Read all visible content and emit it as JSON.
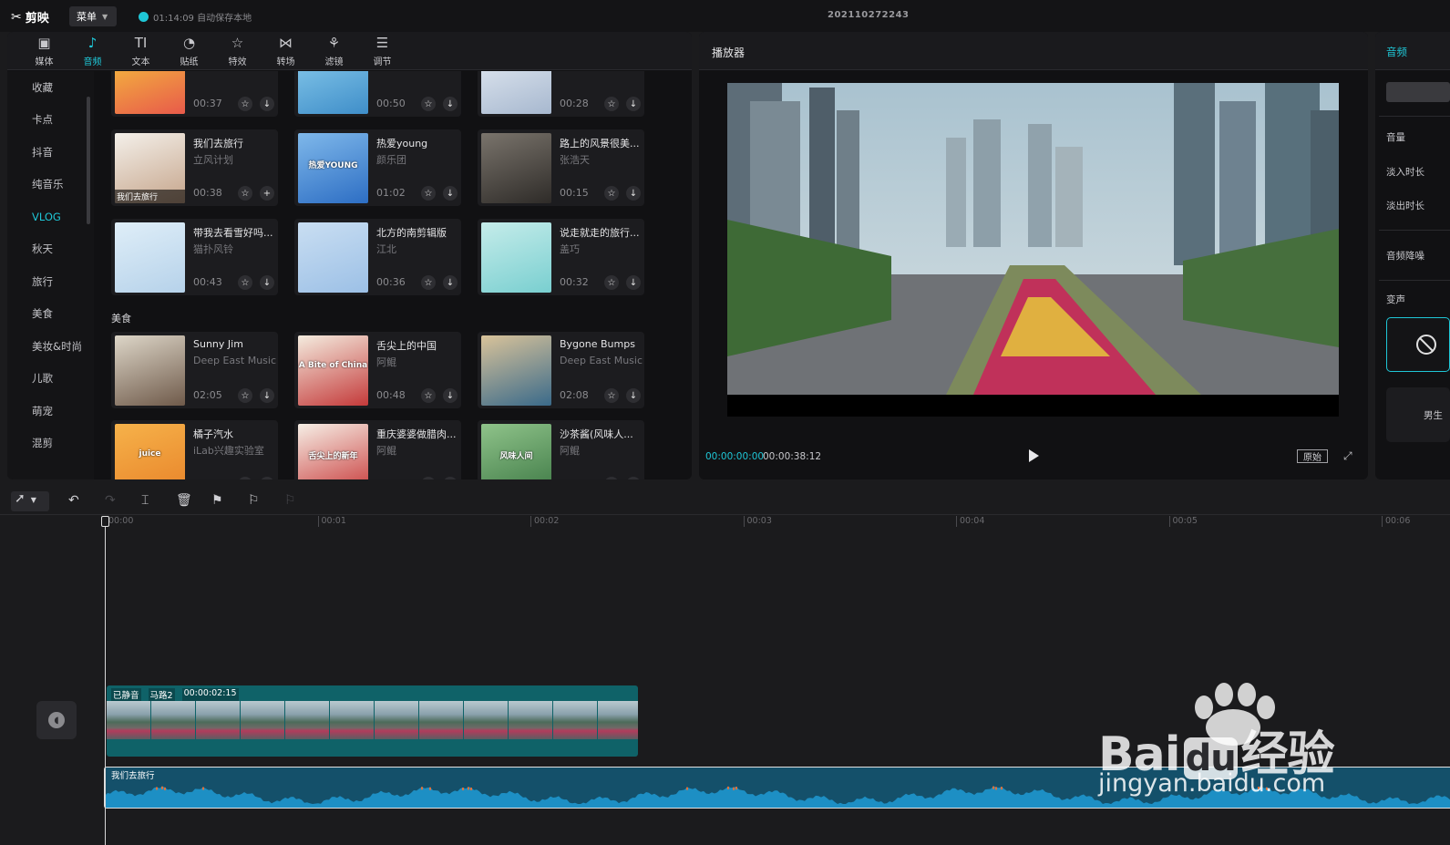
{
  "app": {
    "logo_text": "剪映",
    "menu_label": "菜单",
    "save_status": "01:14:09 自动保存本地",
    "project_title": "202110272243"
  },
  "tabs": [
    {
      "label": "媒体",
      "icon": "media-icon",
      "glyph": "▣"
    },
    {
      "label": "音频",
      "icon": "music-note-icon",
      "glyph": "♪"
    },
    {
      "label": "文本",
      "icon": "text-icon",
      "glyph": "TI"
    },
    {
      "label": "贴纸",
      "icon": "sticker-icon",
      "glyph": "◔"
    },
    {
      "label": "特效",
      "icon": "effects-star-icon",
      "glyph": "☆"
    },
    {
      "label": "转场",
      "icon": "transition-icon",
      "glyph": "⋈"
    },
    {
      "label": "滤镜",
      "icon": "filter-icon",
      "glyph": "⚘"
    },
    {
      "label": "调节",
      "icon": "adjust-sliders-icon",
      "glyph": "☰"
    }
  ],
  "categories": [
    "收藏",
    "卡点",
    "抖音",
    "纯音乐",
    "VLOG",
    "秋天",
    "旅行",
    "美食",
    "美妆&时尚",
    "儿歌",
    "萌宠",
    "混剪"
  ],
  "active_category": "VLOG",
  "section_food": "美食",
  "music_cards": [
    {
      "title": "",
      "artist": "",
      "duration": "00:37",
      "colors": [
        "#f6c93c",
        "#e85a4a"
      ]
    },
    {
      "title": "",
      "artist": "",
      "duration": "00:50",
      "colors": [
        "#8fd0ef",
        "#3f8ec9"
      ]
    },
    {
      "title": "",
      "artist": "",
      "duration": "00:28",
      "colors": [
        "#e8eef5",
        "#a7b8cf"
      ]
    },
    {
      "title": "我们去旅行",
      "artist": "立风计划",
      "duration": "00:38",
      "thumb_caption": "我们去旅行",
      "colors": [
        "#f4f0ea",
        "#c5a48a"
      ]
    },
    {
      "title": "热爱young",
      "artist": "颜乐团",
      "duration": "01:02",
      "thumb_text": "热爱YOUNG",
      "colors": [
        "#7fb8ea",
        "#2d6ec4"
      ]
    },
    {
      "title": "路上的风景很美...",
      "artist": "张浩天",
      "duration": "00:15",
      "colors": [
        "#7a746c",
        "#2e2b28"
      ]
    },
    {
      "title": "带我去看雪好吗...",
      "artist": "猫扑风铃",
      "duration": "00:43",
      "colors": [
        "#dfeef8",
        "#b6d2ea"
      ]
    },
    {
      "title": "北方的南剪辑版",
      "artist": "江北",
      "duration": "00:36",
      "colors": [
        "#c9def2",
        "#9cc0e6"
      ]
    },
    {
      "title": "说走就走的旅行...",
      "artist": "盖巧",
      "duration": "00:32",
      "colors": [
        "#c5ecea",
        "#79cfd0"
      ]
    },
    {
      "title": "Sunny Jim",
      "artist": "Deep East Music",
      "duration": "02:05",
      "colors": [
        "#ddd6c8",
        "#6f5a4a"
      ]
    },
    {
      "title": "舌尖上的中国",
      "artist": "阿鲲",
      "duration": "00:48",
      "thumb_text": "A Bite of China",
      "colors": [
        "#f4ecdf",
        "#c43a3a"
      ]
    },
    {
      "title": "Bygone Bumps",
      "artist": "Deep East Music",
      "duration": "02:08",
      "colors": [
        "#d9c39a",
        "#3a6a8a"
      ]
    },
    {
      "title": "橘子汽水",
      "artist": "iLab兴趣实验室",
      "duration": "",
      "thumb_text": "juice",
      "colors": [
        "#f6b24a",
        "#e8842a"
      ]
    },
    {
      "title": "重庆婆婆做腊肉...",
      "artist": "阿鲲",
      "duration": "",
      "thumb_text": "舌尖上的新年",
      "colors": [
        "#f6efe6",
        "#c83a3a"
      ]
    },
    {
      "title": "沙茶酱(风味人...",
      "artist": "阿鲲",
      "duration": "",
      "thumb_text": "风味人间",
      "colors": [
        "#8fc38a",
        "#3f7a46"
      ]
    }
  ],
  "player": {
    "title": "播放器",
    "current_time": "00:00:00:00",
    "total_time": "00:00:38:12",
    "original_label": "原始"
  },
  "inspector": {
    "tab": "音频",
    "labels": [
      "音量",
      "淡入时长",
      "淡出时长",
      "音频降噪",
      "变声"
    ],
    "voice_option": "男生"
  },
  "timeline": {
    "ruler_labels": [
      "00:00",
      "00:01",
      "00:02",
      "00:03",
      "00:04",
      "00:05",
      "00:06"
    ],
    "video_clip": {
      "muted_label": "已静音",
      "name": "马路2",
      "duration": "00:00:02:15"
    },
    "audio_clip": {
      "name": "我们去旅行"
    }
  },
  "watermark": {
    "brand": "Bai",
    "brand_suffix": "经验",
    "url": "jingyan.baidu.com"
  },
  "colors": {
    "accent": "#1fc6d6",
    "video_clip": "#0f6268",
    "audio_clip": "#14506a",
    "wave": "#1d8fc4",
    "wave_peak": "#e0703a"
  }
}
